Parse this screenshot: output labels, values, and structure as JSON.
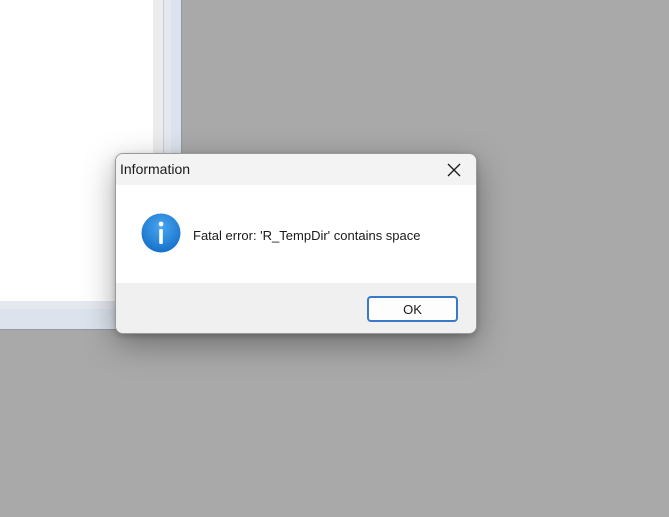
{
  "dialog": {
    "title": "Information",
    "icon": "info-icon",
    "message": "Fatal error: 'R_TempDir' contains space",
    "ok_label": "OK",
    "close_icon": "close-icon"
  },
  "colors": {
    "desktop": "#a9a9a9",
    "accent": "#3a78c8",
    "info_icon": "#1f7fd6"
  }
}
